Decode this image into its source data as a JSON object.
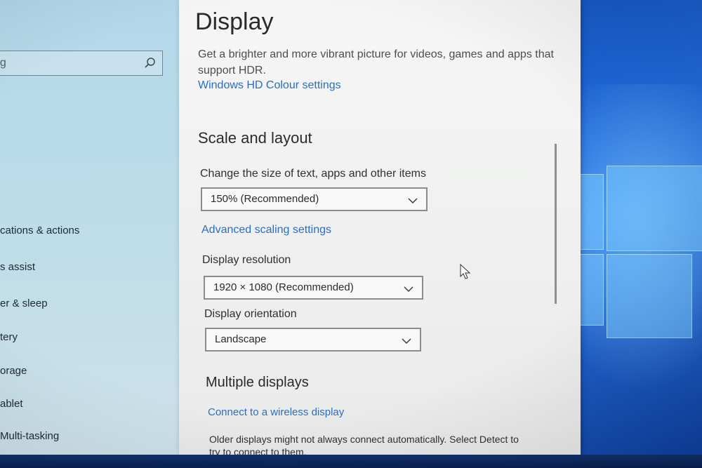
{
  "sidebar": {
    "search_placeholder": "ng",
    "items": [
      {
        "label": "cations & actions"
      },
      {
        "label": "s assist"
      },
      {
        "label": "er & sleep"
      },
      {
        "label": "tery"
      },
      {
        "label": "orage"
      },
      {
        "label": "ablet"
      },
      {
        "label": "Multi-tasking"
      }
    ]
  },
  "main": {
    "title": "Display",
    "hdr_description": "Get a brighter and more vibrant picture for videos, games and apps that support HDR.",
    "hd_colour_link": "Windows HD Colour settings",
    "scale_section": {
      "title": "Scale and layout",
      "size_label": "Change the size of text, apps and other items",
      "size_value": "150% (Recommended)",
      "advanced_link": "Advanced scaling settings",
      "resolution_label": "Display resolution",
      "resolution_value": "1920 × 1080 (Recommended)",
      "orientation_label": "Display orientation",
      "orientation_value": "Landscape"
    },
    "multiple_section": {
      "title": "Multiple displays",
      "wireless_link": "Connect to a wireless display",
      "description": "Older displays might not always connect automatically. Select Detect to try to connect to them."
    }
  },
  "icons": {
    "search": "search-icon",
    "chevron": "chevron-down-icon",
    "cursor": "mouse-pointer-icon",
    "wallpaper_logo": "windows-logo-icon"
  },
  "colors": {
    "accent_link": "#2a6fbf",
    "wallpaper": "#1b63d3",
    "sidebar_bg": "#bfdde9",
    "panel_bg": "#f2f3f2"
  }
}
